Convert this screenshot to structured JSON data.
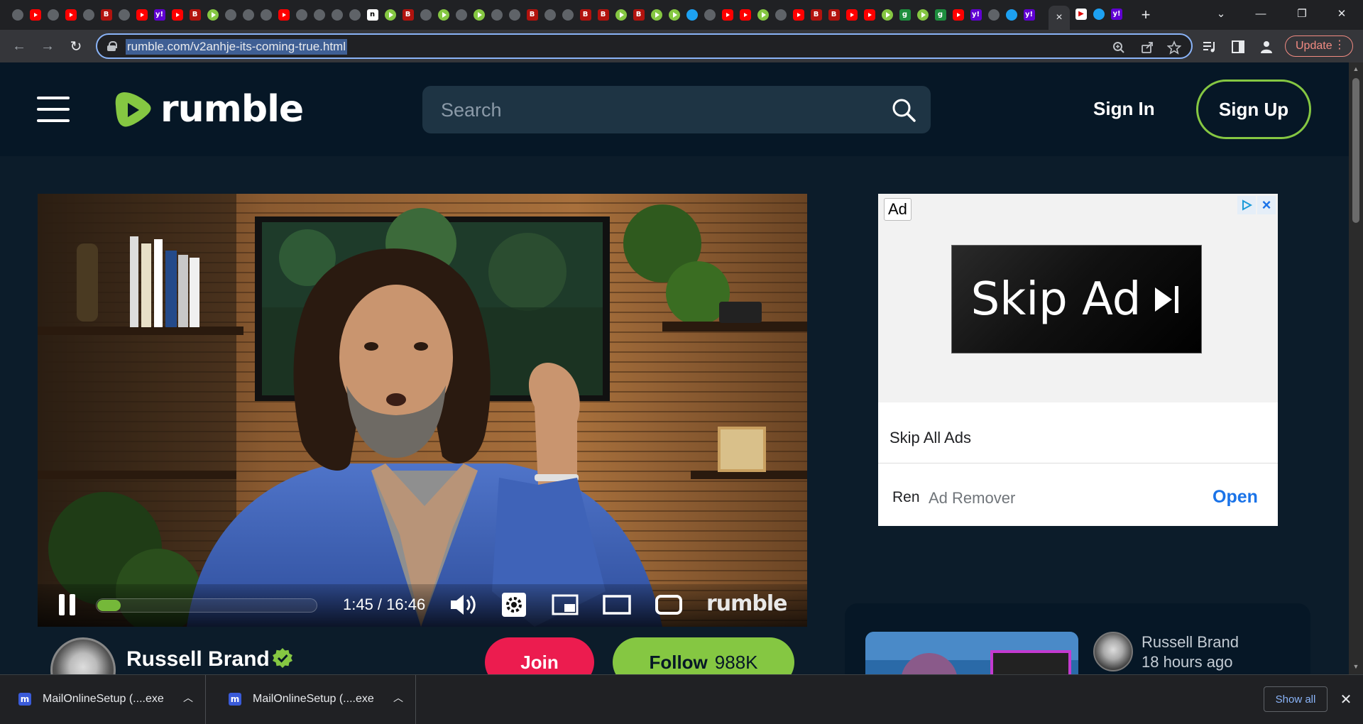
{
  "browser": {
    "tab_favicons": [
      "gl",
      "yt",
      "gl",
      "yt",
      "gl",
      "bi",
      "gl",
      "yt",
      "yh",
      "yt",
      "bi",
      "rum",
      "gl",
      "gl",
      "gl",
      "yt",
      "gl",
      "gl",
      "gl",
      "gl",
      "nn",
      "rum",
      "bi",
      "gl",
      "rum",
      "gl",
      "rum",
      "gl",
      "gl",
      "bi",
      "gl",
      "gl",
      "bi",
      "bi",
      "rum",
      "bi",
      "rum",
      "rum",
      "tw",
      "gl",
      "yt",
      "yt",
      "rum",
      "gl",
      "yt",
      "bi",
      "bi",
      "yt",
      "yt",
      "rum",
      "gg",
      "rum",
      "gg",
      "yt",
      "yh",
      "gl",
      "tw",
      "yh"
    ],
    "tab_letters": {
      "bi": "B",
      "yh": "y!",
      "nn": "n",
      "gg": "g"
    },
    "active_tab_close": "×",
    "new_tab": "+",
    "window_controls": {
      "dropdown": "⌄",
      "minimize": "—",
      "restore": "❐",
      "close": "✕"
    },
    "url": "rumble.com/v2anhje-its-coming-true.html",
    "update_label": "Update"
  },
  "header": {
    "logo_text": "rumble",
    "search_placeholder": "Search",
    "sign_in": "Sign In",
    "sign_up": "Sign Up"
  },
  "player": {
    "progress_fraction": 0.105,
    "timecode": "1:45 / 16:46",
    "brand": "rumble"
  },
  "channel": {
    "name": "Russell Brand",
    "join_label": "Join",
    "follow_label": "Follow",
    "follower_count": "988K"
  },
  "ad": {
    "label": "Ad",
    "skip_text": "Skip Ad",
    "skip_all": "Skip All Ads",
    "sponsor_short": "Ren",
    "sponsor_name": "Ad Remover",
    "cta": "Open"
  },
  "related": {
    "channel": "Russell Brand",
    "posted": "18 hours ago"
  },
  "downloads": {
    "items": [
      {
        "name": "MailOnlineSetup (....exe"
      },
      {
        "name": "MailOnlineSetup (....exe"
      }
    ],
    "show_all": "Show all"
  },
  "colors": {
    "accent": "#85c742",
    "join": "#ec1c4f",
    "page_bg": "#0c1c2a",
    "header_bg": "#061726"
  }
}
